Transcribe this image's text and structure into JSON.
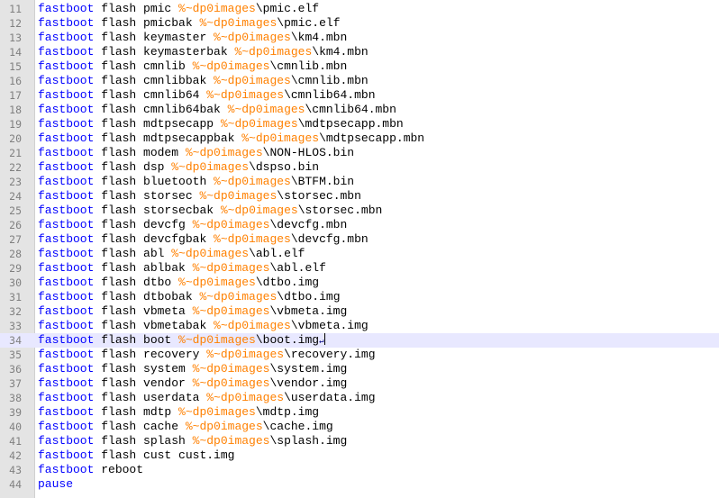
{
  "editor": {
    "lines": [
      {
        "num": "11",
        "kw": "fastboot",
        "cmd": " flash pmic ",
        "var": "%~dp0images",
        "txt": "\\pmic.elf"
      },
      {
        "num": "12",
        "kw": "fastboot",
        "cmd": " flash pmicbak ",
        "var": "%~dp0images",
        "txt": "\\pmic.elf"
      },
      {
        "num": "13",
        "kw": "fastboot",
        "cmd": " flash keymaster ",
        "var": "%~dp0images",
        "txt": "\\km4.mbn"
      },
      {
        "num": "14",
        "kw": "fastboot",
        "cmd": " flash keymasterbak ",
        "var": "%~dp0images",
        "txt": "\\km4.mbn"
      },
      {
        "num": "15",
        "kw": "fastboot",
        "cmd": " flash cmnlib ",
        "var": "%~dp0images",
        "txt": "\\cmnlib.mbn"
      },
      {
        "num": "16",
        "kw": "fastboot",
        "cmd": " flash cmnlibbak ",
        "var": "%~dp0images",
        "txt": "\\cmnlib.mbn"
      },
      {
        "num": "17",
        "kw": "fastboot",
        "cmd": " flash cmnlib64 ",
        "var": "%~dp0images",
        "txt": "\\cmnlib64.mbn"
      },
      {
        "num": "18",
        "kw": "fastboot",
        "cmd": " flash cmnlib64bak ",
        "var": "%~dp0images",
        "txt": "\\cmnlib64.mbn"
      },
      {
        "num": "19",
        "kw": "fastboot",
        "cmd": " flash mdtpsecapp ",
        "var": "%~dp0images",
        "txt": "\\mdtpsecapp.mbn"
      },
      {
        "num": "20",
        "kw": "fastboot",
        "cmd": " flash mdtpsecappbak ",
        "var": "%~dp0images",
        "txt": "\\mdtpsecapp.mbn"
      },
      {
        "num": "21",
        "kw": "fastboot",
        "cmd": " flash modem ",
        "var": "%~dp0images",
        "txt": "\\NON-HLOS.bin"
      },
      {
        "num": "22",
        "kw": "fastboot",
        "cmd": " flash dsp ",
        "var": "%~dp0images",
        "txt": "\\dspso.bin"
      },
      {
        "num": "23",
        "kw": "fastboot",
        "cmd": " flash bluetooth ",
        "var": "%~dp0images",
        "txt": "\\BTFM.bin"
      },
      {
        "num": "24",
        "kw": "fastboot",
        "cmd": " flash storsec ",
        "var": "%~dp0images",
        "txt": "\\storsec.mbn"
      },
      {
        "num": "25",
        "kw": "fastboot",
        "cmd": " flash storsecbak ",
        "var": "%~dp0images",
        "txt": "\\storsec.mbn"
      },
      {
        "num": "26",
        "kw": "fastboot",
        "cmd": " flash devcfg ",
        "var": "%~dp0images",
        "txt": "\\devcfg.mbn"
      },
      {
        "num": "27",
        "kw": "fastboot",
        "cmd": " flash devcfgbak ",
        "var": "%~dp0images",
        "txt": "\\devcfg.mbn"
      },
      {
        "num": "28",
        "kw": "fastboot",
        "cmd": " flash abl ",
        "var": "%~dp0images",
        "txt": "\\abl.elf"
      },
      {
        "num": "29",
        "kw": "fastboot",
        "cmd": " flash ablbak ",
        "var": "%~dp0images",
        "txt": "\\abl.elf"
      },
      {
        "num": "30",
        "kw": "fastboot",
        "cmd": " flash dtbo ",
        "var": "%~dp0images",
        "txt": "\\dtbo.img"
      },
      {
        "num": "31",
        "kw": "fastboot",
        "cmd": " flash dtbobak ",
        "var": "%~dp0images",
        "txt": "\\dtbo.img"
      },
      {
        "num": "32",
        "kw": "fastboot",
        "cmd": " flash vbmeta ",
        "var": "%~dp0images",
        "txt": "\\vbmeta.img"
      },
      {
        "num": "33",
        "kw": "fastboot",
        "cmd": " flash vbmetabak ",
        "var": "%~dp0images",
        "txt": "\\vbmeta.img"
      },
      {
        "num": "34",
        "kw": "fastboot",
        "cmd": " flash boot ",
        "var": "%~dp0images",
        "txt": "\\boot.img",
        "current": true
      },
      {
        "num": "35",
        "kw": "fastboot",
        "cmd": " flash recovery ",
        "var": "%~dp0images",
        "txt": "\\recovery.img"
      },
      {
        "num": "36",
        "kw": "fastboot",
        "cmd": " flash system ",
        "var": "%~dp0images",
        "txt": "\\system.img"
      },
      {
        "num": "37",
        "kw": "fastboot",
        "cmd": " flash vendor ",
        "var": "%~dp0images",
        "txt": "\\vendor.img"
      },
      {
        "num": "38",
        "kw": "fastboot",
        "cmd": " flash userdata ",
        "var": "%~dp0images",
        "txt": "\\userdata.img"
      },
      {
        "num": "39",
        "kw": "fastboot",
        "cmd": " flash mdtp ",
        "var": "%~dp0images",
        "txt": "\\mdtp.img"
      },
      {
        "num": "40",
        "kw": "fastboot",
        "cmd": " flash cache ",
        "var": "%~dp0images",
        "txt": "\\cache.img"
      },
      {
        "num": "41",
        "kw": "fastboot",
        "cmd": " flash splash ",
        "var": "%~dp0images",
        "txt": "\\splash.img"
      },
      {
        "num": "42",
        "kw": "fastboot",
        "cmd": " flash cust cust.img",
        "var": "",
        "txt": ""
      },
      {
        "num": "43",
        "kw": "fastboot",
        "cmd": " reboot",
        "var": "",
        "txt": ""
      },
      {
        "num": "44",
        "kw": "pause",
        "cmd": "",
        "var": "",
        "txt": ""
      }
    ],
    "eol_marker": "↵"
  },
  "colors": {
    "keyword": "#0000ff",
    "variable": "#ff8000",
    "text": "#000000",
    "line_number": "#808080",
    "gutter_bg": "#e4e4e4",
    "current_line_bg": "#e8e8ff"
  }
}
